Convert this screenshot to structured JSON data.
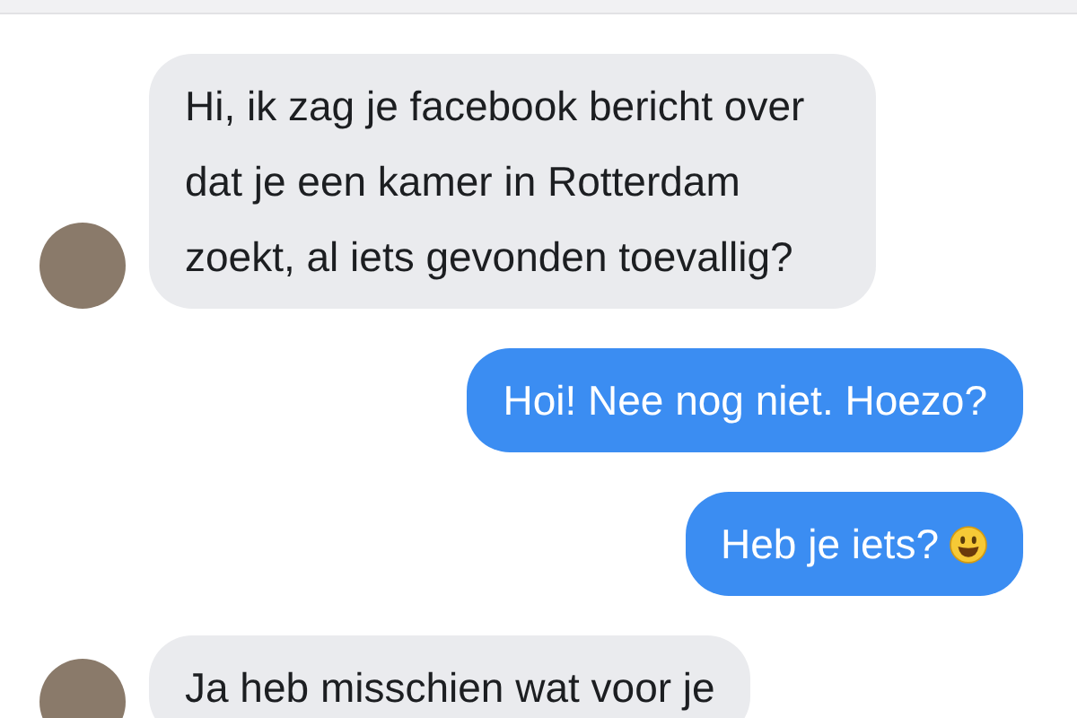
{
  "messages": [
    {
      "kind": "incoming",
      "text": "Hi, ik zag je facebook bericht over dat je een kamer in Rotterdam zoekt, al iets gevonden toevallig?",
      "avatar": true,
      "emoji": false
    },
    {
      "kind": "outgoing",
      "text": "Hoi! Nee nog niet. Hoezo?",
      "avatar": false,
      "emoji": false
    },
    {
      "kind": "outgoing",
      "text": "Heb je iets?",
      "avatar": false,
      "emoji": true
    },
    {
      "kind": "incoming",
      "text": "Ja heb misschien wat voor je",
      "avatar": true,
      "emoji": false
    }
  ]
}
